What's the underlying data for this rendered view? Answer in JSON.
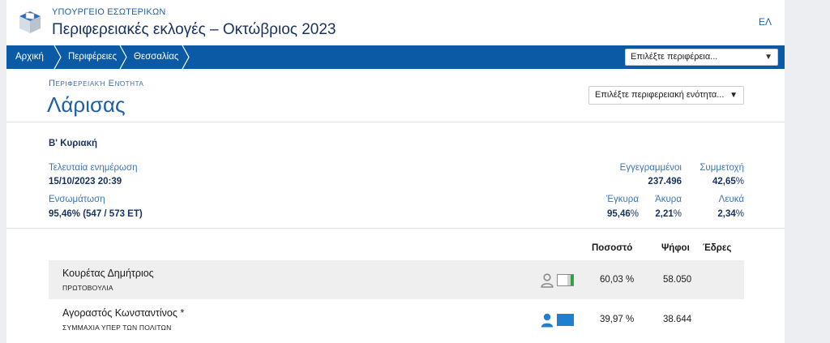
{
  "header": {
    "ministry": "ΥΠΟΥΡΓΕΙΟ ΕΣΩΤΕΡΙΚΩΝ",
    "title": "Περιφερειακές εκλογές – Οκτώβριος 2023",
    "language": "ΕΛ"
  },
  "breadcrumb": [
    {
      "label": "Αρχική"
    },
    {
      "label": "Περιφέρειες"
    },
    {
      "label": "Θεσσαλίας"
    }
  ],
  "region_select": {
    "value": "Επιλέξτε περιφέρεια..."
  },
  "unit": {
    "label": "Περιφερειακή Ενότητα",
    "name": "Λάρισας",
    "select_value": "Επιλέξτε περιφερειακή ενότητα..."
  },
  "summary": {
    "round": "Β' Κυριακή",
    "last_update_label": "Τελευταία ενημέρωση",
    "last_update_value": "15/10/2023 20:39",
    "integration_label": "Ενσωμάτωση",
    "integration_value": "95,46% (547 / 573 ΕΤ)",
    "registered_label": "Εγγεγραμμένοι",
    "registered_value": "237.496",
    "turnout_label": "Συμμετοχή",
    "turnout_value": "42,65",
    "valid_label": "Έγκυρα",
    "valid_value": "95,46",
    "invalid_label": "Άκυρα",
    "invalid_value": "2,21",
    "blank_label": "Λευκά",
    "blank_value": "2,34",
    "percent_sign": "%"
  },
  "table": {
    "headers": {
      "percent": "Ποσοστό",
      "votes": "Ψήφοι",
      "seats": "Έδρες"
    },
    "rows": [
      {
        "name": "Κουρέτας Δημήτριος",
        "party": "ΠΡΩΤΟΒΟΥΛΙΑ",
        "percent": "60,03 %",
        "votes": "58.050",
        "icon_color": "#8a8a8a"
      },
      {
        "name": "Αγοραστός Κωνσταντίνος *",
        "party": "ΣΥΜΜΑΧΙΑ ΥΠΕΡ ΤΩΝ ΠΟΛΙΤΩΝ",
        "percent": "39,97 %",
        "votes": "38.644",
        "icon_color": "#1f7fd1"
      }
    ]
  },
  "colors": {
    "nav_bar": "#0a5aa6",
    "accent": "#1f5fa8",
    "title": "#17325c"
  }
}
